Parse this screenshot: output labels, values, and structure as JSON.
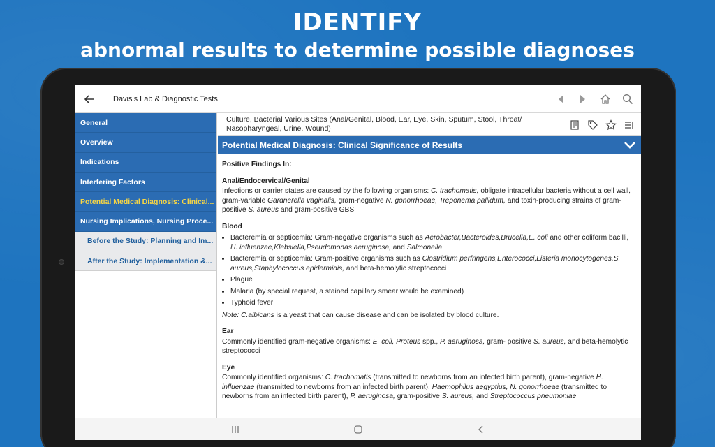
{
  "promo": {
    "title": "IDENTIFY",
    "subtitle": "abnormal results to determine possible diagnoses"
  },
  "appbar": {
    "title": "Davis's Lab & Diagnostic Tests",
    "icons": [
      "back-arrow-icon",
      "prev-icon",
      "next-icon",
      "home-icon",
      "search-icon"
    ]
  },
  "sidebar": {
    "items": [
      {
        "label": "General"
      },
      {
        "label": "Overview"
      },
      {
        "label": "Indications"
      },
      {
        "label": "Interfering Factors"
      },
      {
        "label": "Potential Medical Diagnosis: Clinical..."
      },
      {
        "label": "Nursing Implications, Nursing Proce..."
      }
    ],
    "subitems": [
      {
        "label": "Before the Study: Planning and Im..."
      },
      {
        "label": "After the Study: Implementation &..."
      }
    ]
  },
  "topic": {
    "text": "Culture, Bacterial Various Sites (Anal/Genital, Blood, Ear, Eye, Skin, Sputum, Stool, Throat/ Nasopharyngeal, Urine, Wound)",
    "tool_icons": [
      "notes-icon",
      "tag-icon",
      "star-icon",
      "list-icon"
    ]
  },
  "section": {
    "title": "Potential Medical Diagnosis: Clinical Significance of Results"
  },
  "body": {
    "positive": "Positive Findings In:",
    "anal_h": "Anal/Endocervical/Genital",
    "anal_p": {
      "t1": "Infections or carrier states are caused by the following organisms: ",
      "i1": "C. trachomatis,",
      "t2": " obligate intracellular bacteria without a cell wall, gram-variable ",
      "i2": "Gardnerella vaginalis,",
      "t3": " gram-negative ",
      "i3": "N. gonorrhoeae, Treponema pallidum,",
      "t4": " and toxin-producing strains of gram-positive ",
      "i4": "S. aureus",
      "t5": " and gram-positive GBS"
    },
    "blood_h": "Blood",
    "blood_b1": {
      "t1": "Bacteremia or septicemia: Gram-negative organisms such as ",
      "i1": "Aerobacter,Bacteroides,Brucella,E. coli",
      "t2": " and other coliform bacilli, ",
      "i2": "H. influenzae,Klebsiella,Pseudomonas aeruginosa,",
      "t3": " and ",
      "i3": "Salmonella"
    },
    "blood_b2": {
      "t1": "Bacteremia or septicemia: Gram-positive organisms such as ",
      "i1": "Clostridium perfringens,Enterococci,Listeria monocytogenes,S. aureus,Staphylococcus epidermidis,",
      "t2": " and beta-hemolytic streptococci"
    },
    "blood_b3": "Plague",
    "blood_b4": "Malaria (by special request, a stained capillary smear would be examined)",
    "blood_b5": "Typhoid fever",
    "note": {
      "i1": "Note: C.albicans",
      "t1": " is a yeast that can cause disease and can be isolated by blood culture."
    },
    "ear_h": "Ear",
    "ear_p": {
      "t1": "Commonly identified gram-negative organisms: ",
      "i1": "E. coli, Proteus",
      "t2": " spp., ",
      "i2": "P. aeruginosa,",
      "t3": " gram- positive ",
      "i3": "S. aureus,",
      "t4": " and beta-hemolytic streptococci"
    },
    "eye_h": "Eye",
    "eye_p": {
      "t1": "Commonly identified organisms: ",
      "i1": "C. trachomatis",
      "t2": " (transmitted to newborns from an infected birth parent), gram-negative ",
      "i2": "H. influenzae",
      "t3": " (transmitted to newborns from an infected birth parent), ",
      "i3": "Haemophilus aegyptius, N. gonorrhoeae",
      "t4": " (transmitted to newborns from an infected birth parent), ",
      "i4": "P. aeruginosa,",
      "t5": " gram-positive ",
      "i5": "S. aureus,",
      "t6": " and ",
      "i6": "Streptococcus pneumoniae"
    }
  },
  "navbar": {
    "icons": [
      "recents-icon",
      "home-button-icon",
      "back-nav-icon"
    ]
  },
  "colors": {
    "background": "#1e74bf",
    "nav_blue": "#2b6cb3",
    "active_yellow": "#f6d545",
    "sub_text": "#1f5e9c"
  }
}
